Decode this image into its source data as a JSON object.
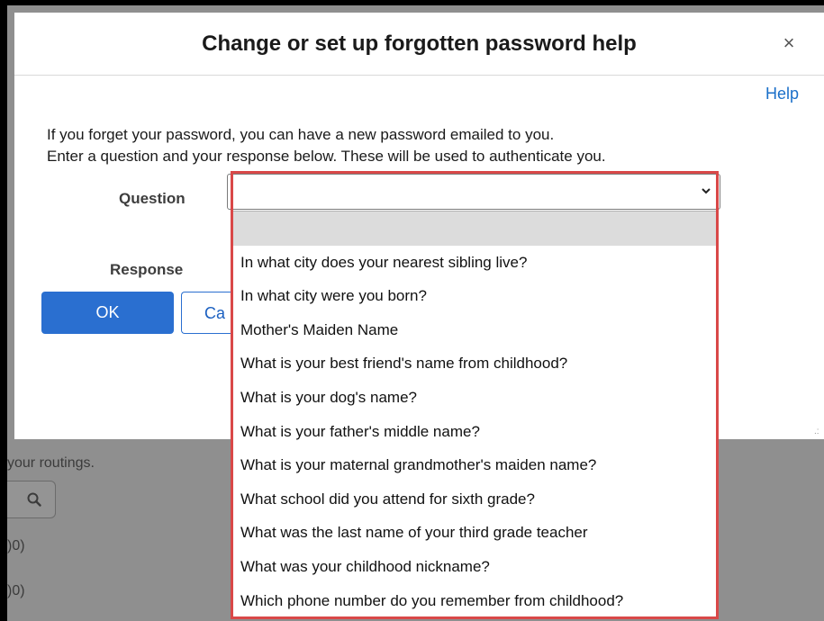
{
  "dialog": {
    "title": "Change or set up forgotten password help",
    "close_icon": "close-icon",
    "help_link": "Help",
    "instructions": [
      "If you forget your password, you can have a new password emailed to you.",
      "Enter a question and your response below. These will be used to authenticate you."
    ],
    "question_label": "Question",
    "response_label": "Response",
    "question_value": "",
    "ok_label": "OK",
    "cancel_label_visible": "Ca"
  },
  "dropdown": {
    "options": [
      "",
      "In what city does your nearest sibling live?",
      "In what city were you born?",
      "Mother's Maiden Name",
      "What is your best friend's name from childhood?",
      "What is your dog's name?",
      "What is your father's middle name?",
      "What is your maternal grandmother's maiden name?",
      "What school did you attend for sixth grade?",
      "What was the last name of your third grade teacher",
      "What was your childhood nickname?",
      "Which phone number do you remember from childhood?"
    ],
    "highlighted_index": 0
  },
  "background": {
    "routing_text": "your routings.",
    "row1_text": ")0)",
    "row2_text": ")0)",
    "search_icon": "search-icon"
  },
  "colors": {
    "primary": "#2a6fd0",
    "highlight_border": "#d94848"
  }
}
